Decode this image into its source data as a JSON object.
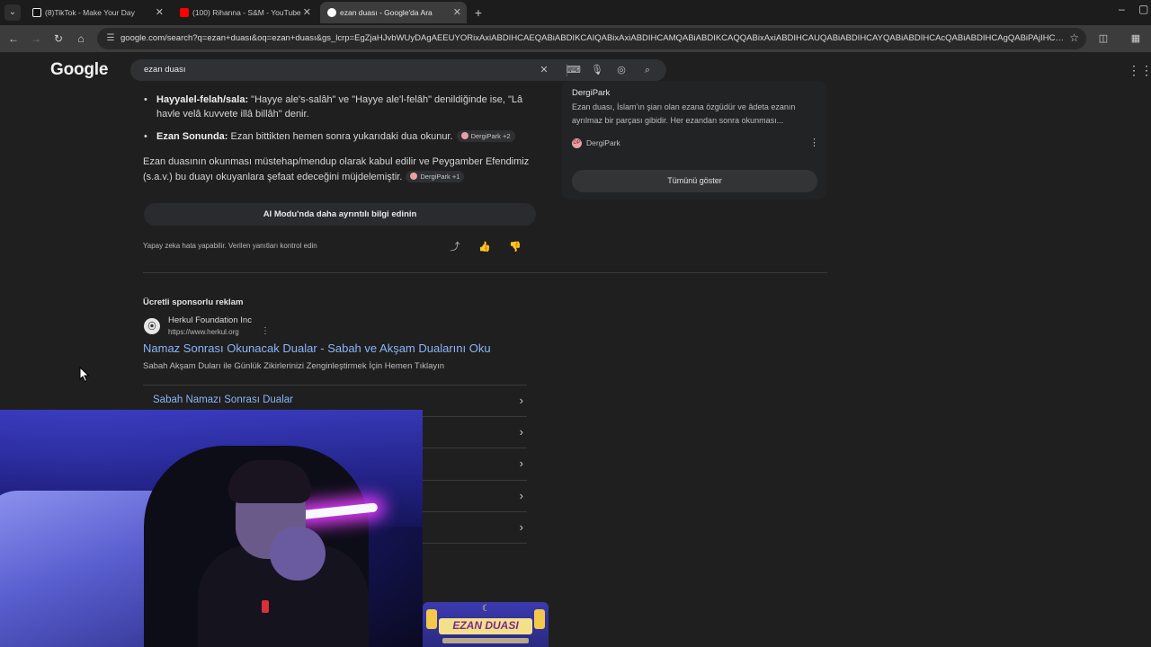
{
  "browser": {
    "tabs": [
      {
        "title": "(8)TikTok - Make Your Day",
        "active": false,
        "favicon_color": "#ffffff"
      },
      {
        "title": "(100) Rihanna - S&M - YouTube",
        "active": false,
        "favicon_color": "#ff0000"
      },
      {
        "title": "ezan duası - Google'da Ara",
        "active": true,
        "favicon_color": "#4285f4"
      }
    ],
    "new_tab": "+",
    "window_controls": [
      "–",
      "▢"
    ],
    "url": "google.com/search?q=ezan+duası&oq=ezan+duası&gs_lcrp=EgZjaHJvbWUyDAgAEEUYORixAxiABDIHCAEQABiABDIKCAIQABixAxiABDIHCAMQABiABDIKCAQQABixAxiABDIHCAUQABiABDIHCAYQABiABDIHCAcQABiABDIHCAgQABiPAjIHCAkQA..."
  },
  "google": {
    "logo": "Google",
    "search_query": "ezan duası"
  },
  "ai_overview": {
    "bullets": [
      {
        "bold": "Hayyalel-felah/sala:",
        "text": " \"Hayye ale's-salâh\" ve \"Hayye ale'l-felâh\" denildiğinde ise, \"Lâ havle velâ kuvvete illâ billâh\" denir.",
        "chip": ""
      },
      {
        "bold": "Ezan Sonunda:",
        "text": " Ezan bittikten hemen sonra yukarıdaki dua okunur.",
        "chip": "DergiPark +2"
      }
    ],
    "paragraph": "Ezan duasının okunması müstehap/mendup olarak kabul edilir ve Peygamber Efendimiz (s.a.v.) bu duayı okuyanlara şefaat edeceğini müjdelemiştir.",
    "paragraph_chip": "DergiPark +1",
    "ai_mode_button": "AI Modu'nda daha ayrıntılı bilgi edinin",
    "disclaimer": "Yapay zeka hata yapabilir. Verilen yanıtları kontrol edin"
  },
  "side_card": {
    "title": "DergiPark",
    "text": "Ezan duası, İslam'ın şiarı olan ezana özgüdür ve âdeta ezanın ayrılmaz bir parçası gibidir. Her ezandan sonra okunması...",
    "source": "DergiPark",
    "source_icon": "DP",
    "show_all": "Tümünü göster"
  },
  "sponsored": {
    "label": "Ücretli sponsorlu reklam",
    "advertiser": "Herkul Foundation Inc",
    "url": "https://www.herkul.org",
    "title": "Namaz Sonrası Okunacak Dualar - Sabah ve Akşam Dualarını Oku",
    "description": "Sabah Akşam Duları ile Günlük Zikirlerinizi Zenginleştirmek İçin Hemen Tıklayın",
    "links": [
      "Sabah Namazı Sonrası Dualar",
      "",
      "",
      "",
      ""
    ]
  },
  "thumbnail": {
    "title": "EZAN DUASI"
  },
  "icons": {
    "share": "share-icon",
    "thumbs_up": "thumbs-up-icon",
    "thumbs_down": "thumbs-down-icon",
    "keyboard": "keyboard-icon",
    "mic": "microphone-icon",
    "lens": "lens-icon",
    "search": "search-icon",
    "clear": "close-icon",
    "apps": "apps-grid-icon"
  },
  "colors": {
    "link": "#8ab4f8",
    "background": "#1f1f1f",
    "chip_dot": "#e8a0a8"
  }
}
